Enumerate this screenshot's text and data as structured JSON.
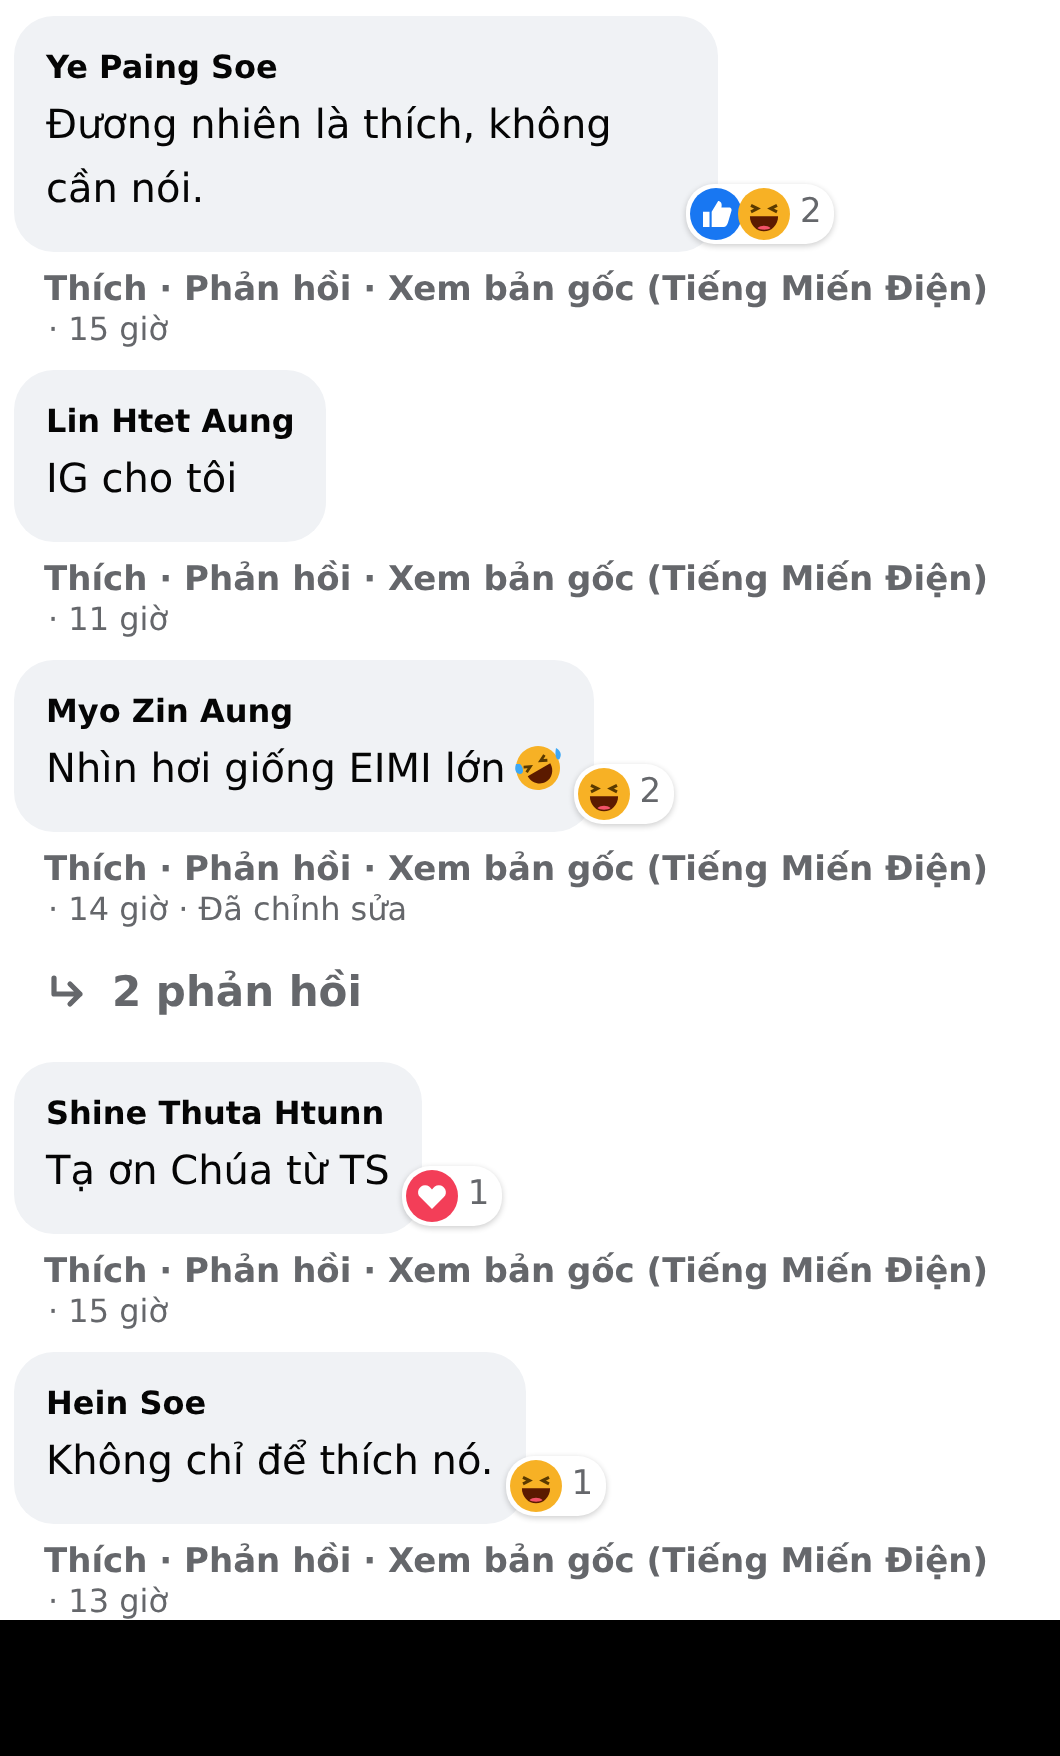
{
  "separator": "·",
  "comments": [
    {
      "author": "Ye Paing Soe",
      "text": "Đương nhiên là thích, không cần nói.",
      "reactions": [
        {
          "kind": "like"
        },
        {
          "kind": "haha"
        }
      ],
      "reaction_count": "2",
      "actions": [
        "Thích",
        "Phản hồi",
        "Xem bản gốc (Tiếng Miến Điện)"
      ],
      "meta": [
        "15 giờ"
      ]
    },
    {
      "author": "Lin Htet Aung",
      "text": "IG cho tôi",
      "actions": [
        "Thích",
        "Phản hồi",
        "Xem bản gốc (Tiếng Miến Điện)"
      ],
      "meta": [
        "11 giờ"
      ]
    },
    {
      "author": "Myo Zin Aung",
      "text": "Nhìn hơi giống EIMI lớn",
      "inline_emoji": {
        "kind": "rofl"
      },
      "reactions": [
        {
          "kind": "haha"
        }
      ],
      "reaction_count": "2",
      "actions": [
        "Thích",
        "Phản hồi",
        "Xem bản gốc (Tiếng Miến Điện)"
      ],
      "meta": [
        "14 giờ",
        "Đã chỉnh sửa"
      ],
      "replies_link": "2 phản hồi"
    },
    {
      "author": "Shine Thuta Htunn",
      "text": "Tạ ơn Chúa từ TS",
      "reactions": [
        {
          "kind": "love"
        }
      ],
      "reaction_count": "1",
      "actions": [
        "Thích",
        "Phản hồi",
        "Xem bản gốc (Tiếng Miến Điện)"
      ],
      "meta": [
        "15 giờ"
      ]
    },
    {
      "author": "Hein Soe",
      "text": "Không chỉ để thích nó.",
      "reactions": [
        {
          "kind": "haha"
        }
      ],
      "reaction_count": "1",
      "actions": [
        "Thích",
        "Phản hồi",
        "Xem bản gốc (Tiếng Miến Điện)"
      ],
      "meta": [
        "13 giờ"
      ]
    }
  ]
}
